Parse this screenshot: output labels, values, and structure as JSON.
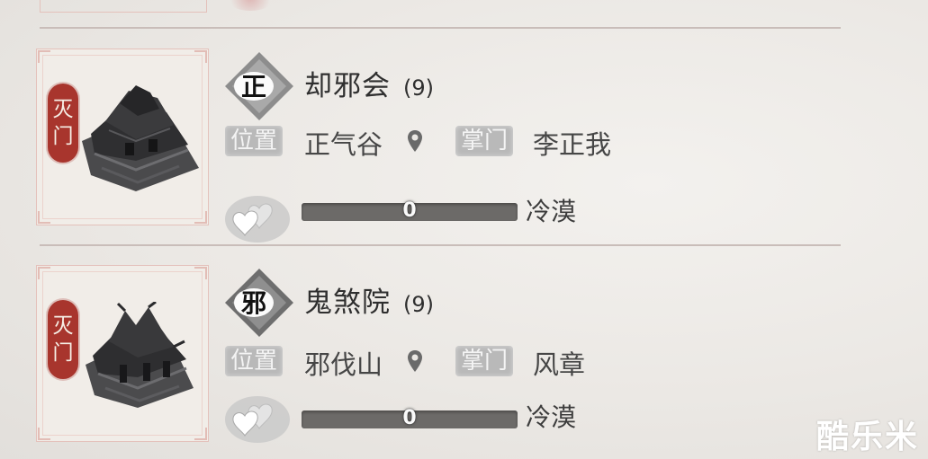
{
  "sects": [
    {
      "status": "灭门",
      "alignment": "正",
      "name": "却邪会",
      "count": "(9)",
      "location_label": "位置",
      "location": "正气谷",
      "leader_label": "掌门",
      "leader": "李正我",
      "favor_value": "0",
      "mood": "冷漠"
    },
    {
      "status": "灭门",
      "alignment": "邪",
      "name": "鬼煞院",
      "count": "(9)",
      "location_label": "位置",
      "location": "邪伐山",
      "leader_label": "掌门",
      "leader": "风章",
      "favor_value": "0",
      "mood": "冷漠"
    }
  ],
  "watermark": "酷乐米",
  "colors": {
    "status_ribbon": "#a8352d",
    "tag_bg": "#b9b9b9",
    "bar_bg": "#6c6a68",
    "frame_border": "#e4c1bb"
  },
  "icons": {
    "location": "map-pin-icon",
    "favor": "hearts-icon"
  }
}
